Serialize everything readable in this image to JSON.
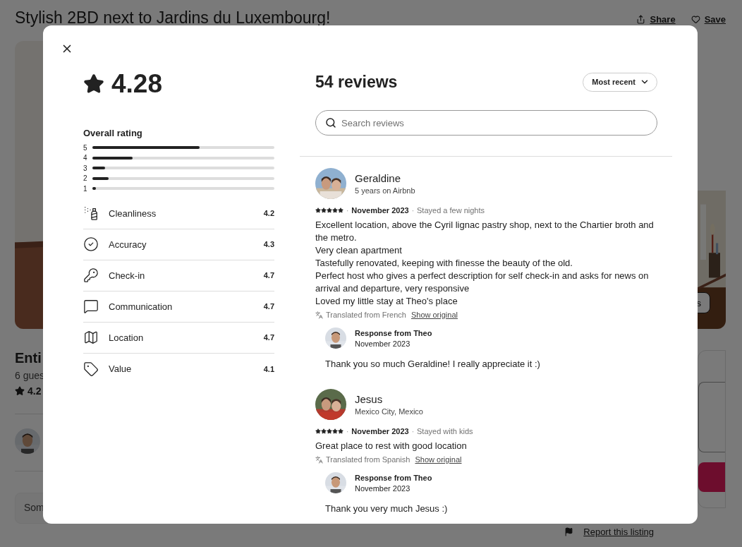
{
  "page": {
    "title": "Stylish 2BD next to Jardins du Luxembourg!",
    "actions": [
      {
        "label": "Share"
      },
      {
        "label": "Save"
      }
    ],
    "photo_button": "s",
    "summary": {
      "heading": "Enti",
      "guests": "6 gues",
      "rating": "4.2"
    },
    "notice": "Som",
    "report_link": "Report this listing"
  },
  "modal": {
    "rating": "4.28",
    "reviews_count": "54 reviews",
    "sort": "Most recent",
    "search_placeholder": "Search reviews",
    "meta_separator": "·",
    "overall_label": "Overall rating",
    "rating_breakdown": [
      {
        "label": "5",
        "level": 0.59
      },
      {
        "label": "4",
        "level": 0.22
      },
      {
        "label": "3",
        "level": 0.07
      },
      {
        "label": "2",
        "level": 0.09
      },
      {
        "label": "1",
        "level": 0.02
      }
    ],
    "categories": [
      {
        "label": "Cleanliness",
        "value": "4.2"
      },
      {
        "label": "Accuracy",
        "value": "4.3"
      },
      {
        "label": "Check-in",
        "value": "4.7"
      },
      {
        "label": "Communication",
        "value": "4.7"
      },
      {
        "label": "Location",
        "value": "4.7"
      },
      {
        "label": "Value",
        "value": "4.1"
      }
    ],
    "reviews": [
      {
        "name": "Geraldine",
        "subtitle": "5 years on Airbnb",
        "stars": 5,
        "date": "November 2023",
        "stay": "Stayed a few nights",
        "body": "Excellent location, above the Cyril lignac pastry shop, next to the Chartier broth and the metro.\nVery clean apartment\nTastefully renovated, keeping with finesse the beauty of the old.\nPerfect host who gives a perfect description for self check-in and asks for news on arrival and departure, very responsive\nLoved my little stay at Theo's place",
        "translation": {
          "text": "Translated from French",
          "link": "Show original"
        },
        "response": {
          "author": "Response from Theo",
          "date": "November 2023",
          "text": "Thank you so much Geraldine! I really appreciate it :)"
        }
      },
      {
        "name": "Jesus",
        "subtitle": "Mexico City, Mexico",
        "stars": 5,
        "date": "November 2023",
        "stay": "Stayed with kids",
        "body": "Great place to rest with good location",
        "translation": {
          "text": "Translated from Spanish",
          "link": "Show original"
        },
        "response": {
          "author": "Response from Theo",
          "date": "November 2023",
          "text": "Thank you very much Jesus :)"
        }
      }
    ]
  }
}
